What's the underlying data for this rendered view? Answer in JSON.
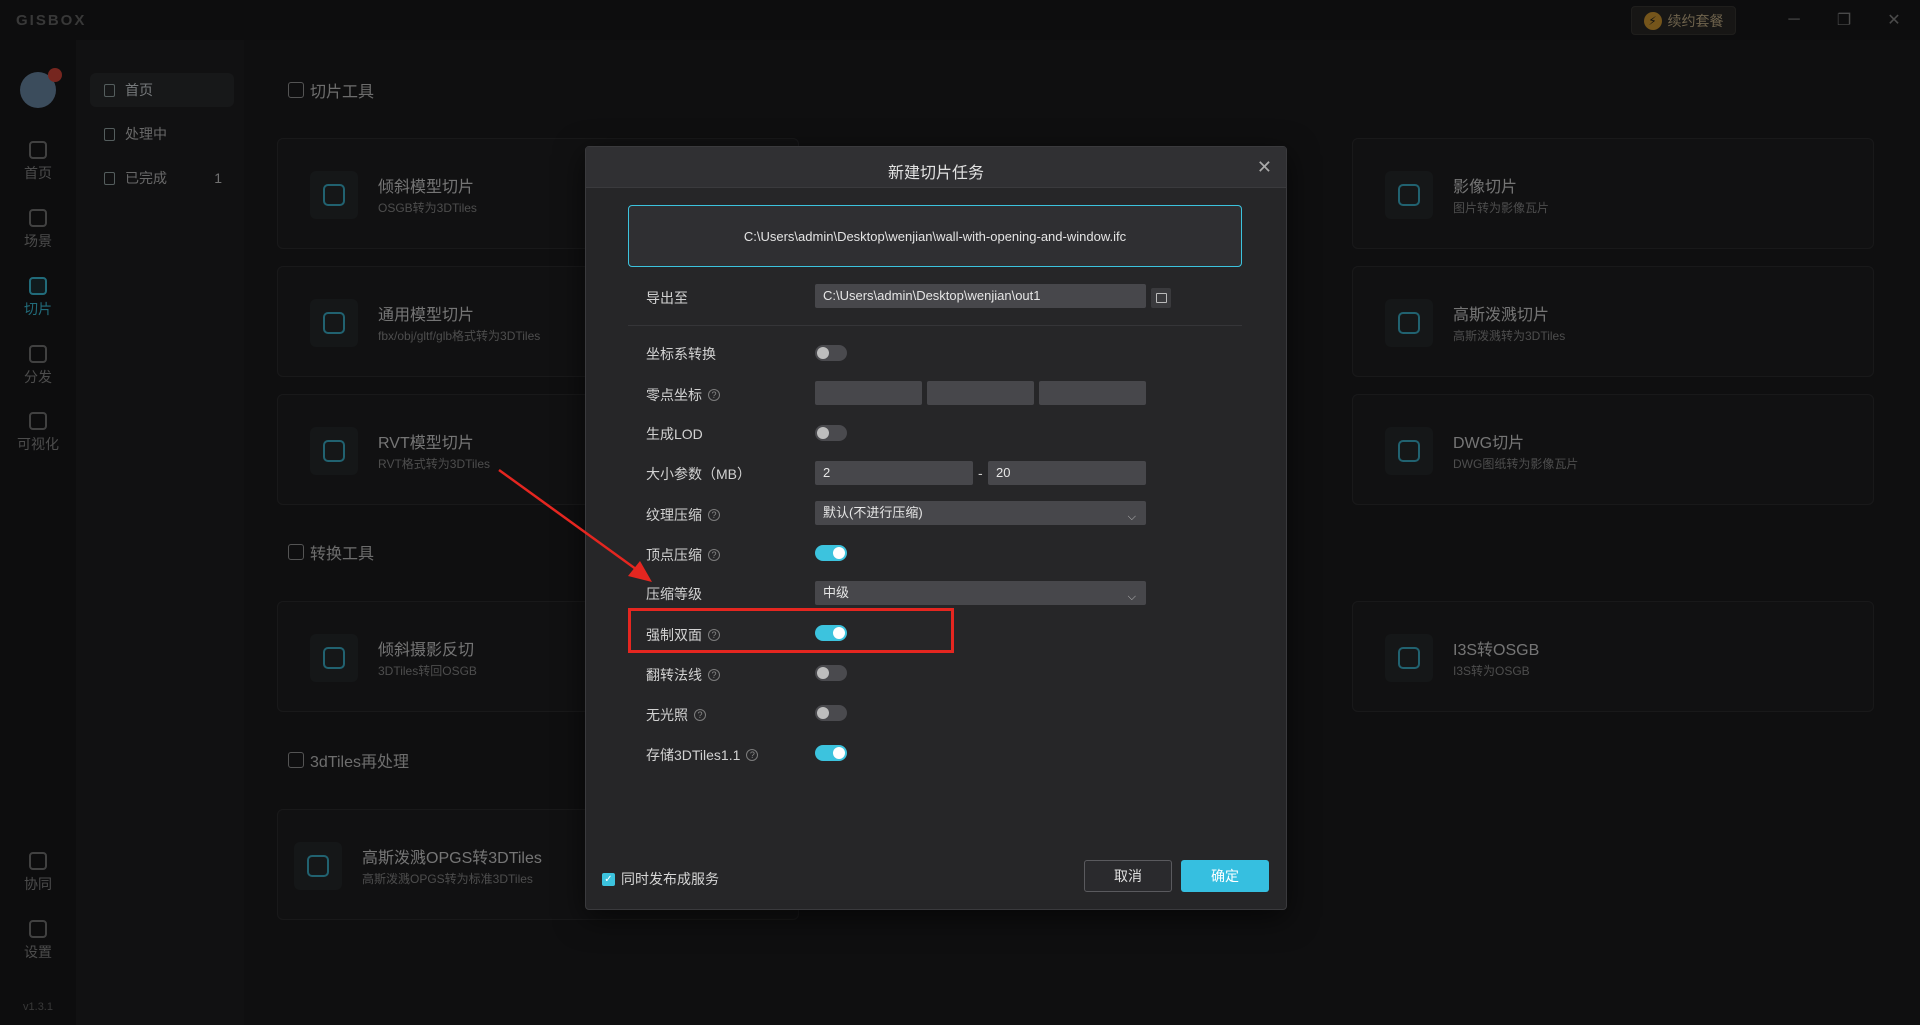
{
  "app": {
    "logo": "GISBOX",
    "renew_label": "续约套餐",
    "win_min": "─",
    "win_max": "❐",
    "win_close": "✕",
    "version": "v1.3.1"
  },
  "rail": [
    {
      "label": "首页"
    },
    {
      "label": "场景"
    },
    {
      "label": "切片"
    },
    {
      "label": "分发"
    },
    {
      "label": "可视化"
    },
    {
      "label": "协同"
    },
    {
      "label": "设置"
    }
  ],
  "sub": [
    {
      "label": "首页"
    },
    {
      "label": "处理中"
    },
    {
      "label": "已完成",
      "count": "1"
    }
  ],
  "sections": {
    "slice": "切片工具",
    "convert": "转换工具",
    "reprocess": "3dTiles再处理"
  },
  "cards": [
    {
      "title": "倾斜模型切片",
      "desc": "OSGB转为3DTiles"
    },
    {
      "title": "影像切片",
      "desc": "图片转为影像瓦片"
    },
    {
      "title": "通用模型切片",
      "desc": "fbx/obj/gltf/glb格式转为3DTiles"
    },
    {
      "title": "高斯泼溅切片",
      "desc": "高斯泼溅转为3DTiles"
    },
    {
      "title": "RVT模型切片",
      "desc": "RVT格式转为3DTiles"
    },
    {
      "title": "DWG切片",
      "desc": "DWG图纸转为影像瓦片"
    },
    {
      "title": "倾斜摄影反切",
      "desc": "3DTiles转回OSGB"
    },
    {
      "title": "I3S转OSGB",
      "desc": "I3S转为OSGB"
    },
    {
      "title": "高斯泼溅OPGS转3DTiles",
      "desc": "高斯泼溅OPGS转为标准3DTiles"
    }
  ],
  "dialog": {
    "title": "新建切片任务",
    "close": "✕",
    "file_path": "C:\\Users\\admin\\Desktop\\wenjian\\wall-with-opening-and-window.ifc",
    "export_label": "导出至",
    "export_path": "C:\\Users\\admin\\Desktop\\wenjian\\out1",
    "coord_label": "坐标系转换",
    "zero_label": "零点坐标",
    "lod_label": "生成LOD",
    "size_label": "大小参数（MB）",
    "size_min": "2",
    "size_sep": "-",
    "size_max": "20",
    "texture_label": "纹理压缩",
    "texture_value": "默认(不进行压缩)",
    "vertex_label": "顶点压缩",
    "level_label": "压缩等级",
    "level_value": "中级",
    "doubleside_label": "强制双面",
    "flip_label": "翻转法线",
    "nolight_label": "无光照",
    "store_label": "存储3DTiles1.1",
    "publish_label": "同时发布成服务",
    "cancel": "取消",
    "ok": "确定",
    "help": "?",
    "check": "✓",
    "chev": "⌵"
  },
  "toggles": {
    "coord": false,
    "lod": false,
    "vertex": true,
    "doubleside": true,
    "flip": false,
    "nolight": false,
    "store": true
  }
}
